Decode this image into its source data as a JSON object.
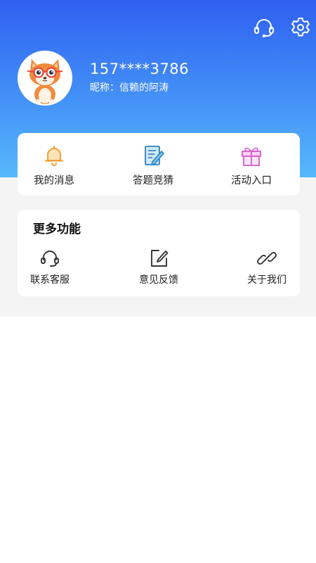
{
  "profile": {
    "phone": "157****3786",
    "nickname": "昵称：信赖的阿涛"
  },
  "header": {
    "icons": [
      "headset-icon",
      "gear-icon"
    ]
  },
  "quick_actions": [
    {
      "label": "我的消息",
      "icon": "bell-icon",
      "color": "#f3a23a"
    },
    {
      "label": "答题竞猜",
      "icon": "edit-document-icon",
      "color": "#3a8fd6"
    },
    {
      "label": "活动入口",
      "icon": "gift-icon",
      "color": "#e163d4"
    }
  ],
  "more": {
    "title": "更多功能",
    "items": [
      {
        "label": "联系客服",
        "icon": "headset-icon"
      },
      {
        "label": "意见反馈",
        "icon": "feedback-edit-icon"
      },
      {
        "label": "关于我们",
        "icon": "link-icon"
      }
    ]
  },
  "colors": {
    "header_top": "#2f5ff1",
    "header_bottom": "#57b8fb",
    "background": "#f4f4f4"
  }
}
